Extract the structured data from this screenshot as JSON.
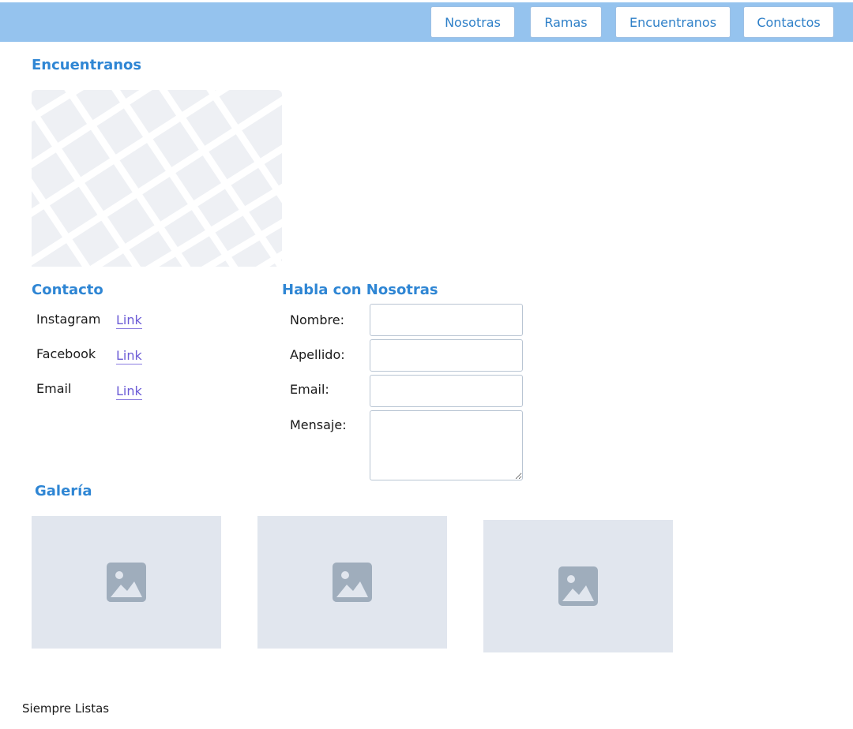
{
  "nav": {
    "items": [
      {
        "label": "Nosotras"
      },
      {
        "label": "Ramas"
      },
      {
        "label": "Encuentranos"
      },
      {
        "label": "Contactos"
      }
    ]
  },
  "find_us": {
    "title": "Encuentranos",
    "map_icon": "map-placeholder"
  },
  "contact": {
    "title": "Contacto",
    "rows": [
      {
        "label": "Instagram",
        "link": "Link"
      },
      {
        "label": "Facebook",
        "link": "Link"
      },
      {
        "label": "Email",
        "link": "Link"
      }
    ]
  },
  "form": {
    "title": "Habla con Nosotras",
    "fields": [
      {
        "label": "Nombre:",
        "value": ""
      },
      {
        "label": "Apellido:",
        "value": ""
      },
      {
        "label": "Email:",
        "value": ""
      },
      {
        "label": "Mensaje:",
        "value": ""
      }
    ]
  },
  "gallery": {
    "title": "Galería",
    "image_icon": "image-icon"
  },
  "footer": {
    "text": "Siempre Listas"
  },
  "colors": {
    "topbar": "#95c3ee",
    "accent": "#2f86d4",
    "link": "#6b5bd6",
    "placeholder_bg": "#e1e6ee",
    "placeholder_icon": "#9fadbc"
  }
}
